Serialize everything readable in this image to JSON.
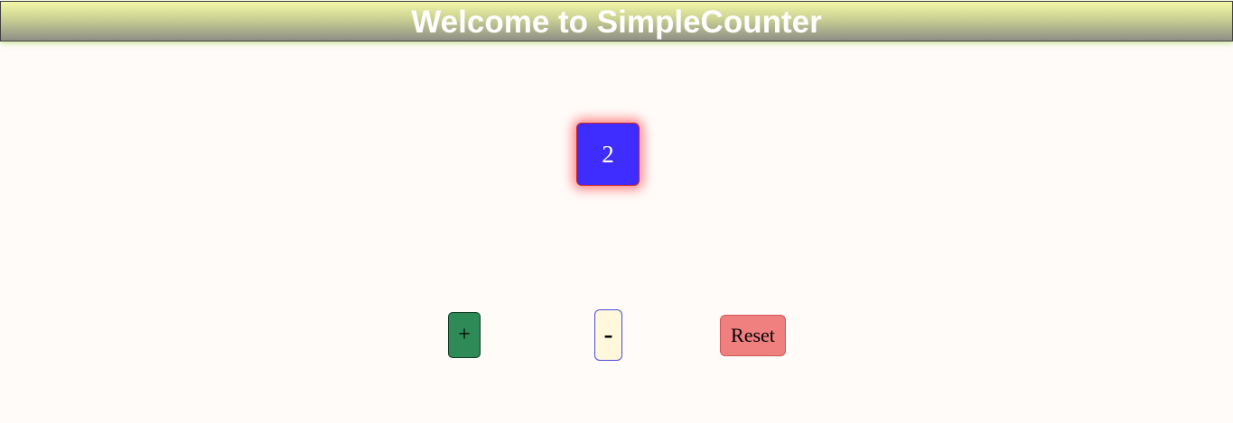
{
  "header": {
    "title": "Welcome to SimpleCounter"
  },
  "counter": {
    "value": "2"
  },
  "controls": {
    "increment_label": "+",
    "decrement_label": "-",
    "reset_label": "Reset"
  },
  "colors": {
    "counter_background": "#3f2cff",
    "increment_background": "#2e8b57",
    "decrement_background": "#fff8dc",
    "reset_background": "#f08080",
    "page_background": "#fffbf9"
  }
}
